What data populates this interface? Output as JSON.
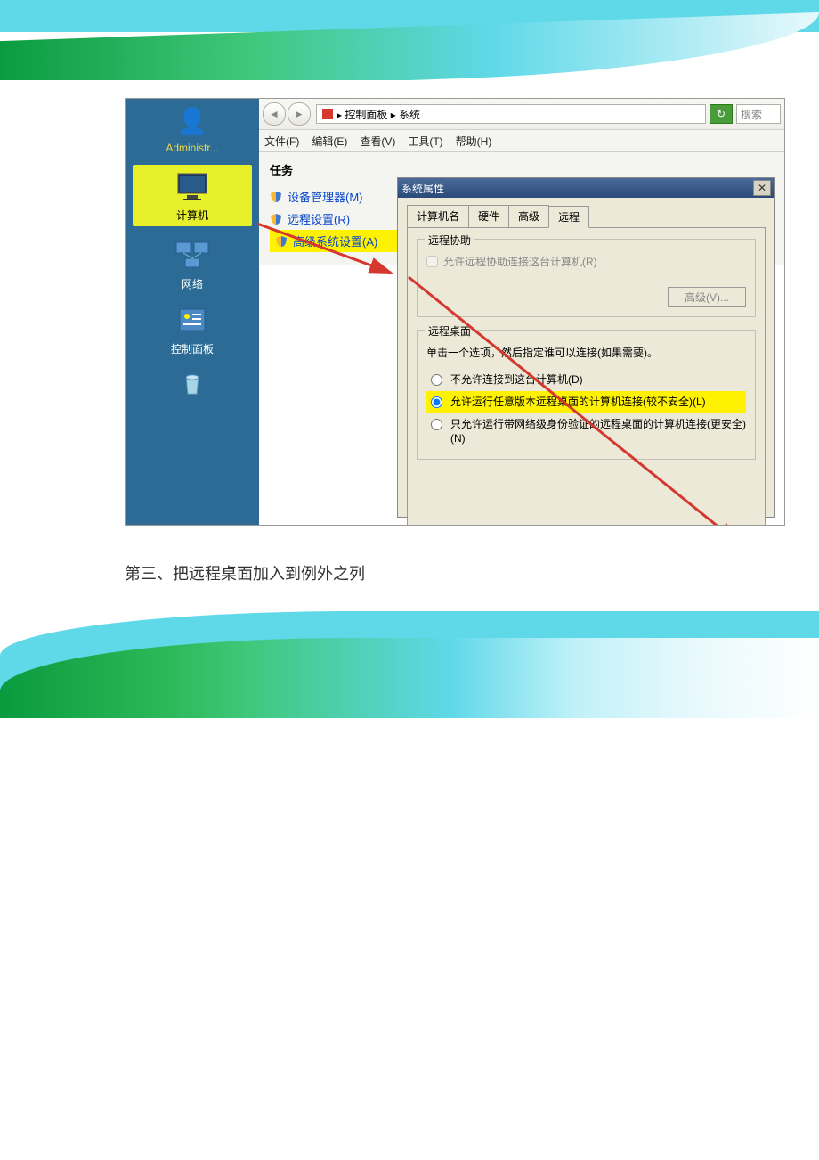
{
  "desktop": {
    "admin": "Administr...",
    "computer": "计算机",
    "network": "网络",
    "control_panel": "控制面板"
  },
  "explorer": {
    "breadcrumb": " ▸ 控制面板 ▸ 系统",
    "search": "搜索",
    "menu": {
      "file": "文件(F)",
      "edit": "编辑(E)",
      "view": "查看(V)",
      "tools": "工具(T)",
      "help": "帮助(H)"
    },
    "tasks_title": "任务",
    "tasks": {
      "device_mgr": "设备管理器(M)",
      "remote_settings": "远程设置(R)",
      "advanced_settings": "高级系统设置(A)"
    }
  },
  "dialog": {
    "title": "系统属性",
    "tabs": {
      "computer_name": "计算机名",
      "hardware": "硬件",
      "advanced": "高级",
      "remote": "远程"
    },
    "remote_assist": {
      "group": "远程协助",
      "allow": "允许远程协助连接这台计算机(R)",
      "advanced_btn": "高级(V)..."
    },
    "remote_desktop": {
      "group": "远程桌面",
      "instruction": "单击一个选项，然后指定谁可以连接(如果需要)。",
      "opt1": "不允许连接到这台计算机(D)",
      "opt2": "允许运行任意版本远程桌面的计算机连接(较不安全)(L)",
      "opt3": "只允许运行带网络级身份验证的远程桌面的计算机连接(更安全)(N)"
    }
  },
  "caption": "第三、把远程桌面加入到例外之列"
}
